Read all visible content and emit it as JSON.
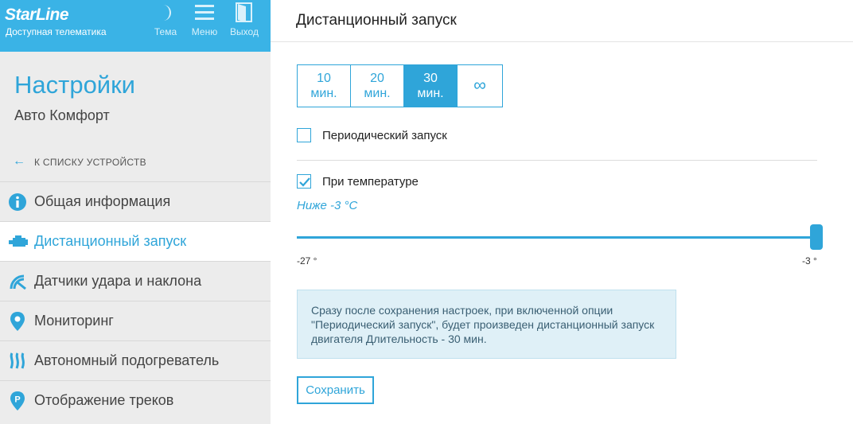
{
  "header": {
    "brand": "StarLine",
    "brand_sub": "Доступная телематика",
    "buttons": {
      "theme": "Тема",
      "menu": "Меню",
      "exit": "Выход"
    }
  },
  "sidebar": {
    "title": "Настройки",
    "subtitle": "Авто Комфорт",
    "back_label": "К СПИСКУ УСТРОЙСТВ",
    "items": [
      {
        "label": "Общая информация",
        "icon": "info-icon"
      },
      {
        "label": "Дистанционный запуск",
        "icon": "engine-icon",
        "active": true
      },
      {
        "label": "Датчики удара и наклона",
        "icon": "shock-sensor-icon"
      },
      {
        "label": "Мониторинг",
        "icon": "location-pin-icon"
      },
      {
        "label": "Автономный подогреватель",
        "icon": "heater-icon"
      },
      {
        "label": "Отображение треков",
        "icon": "parking-pin-icon"
      }
    ]
  },
  "main": {
    "title": "Дистанционный запуск",
    "durations": [
      {
        "value": "10",
        "unit": "мин."
      },
      {
        "value": "20",
        "unit": "мин."
      },
      {
        "value": "30",
        "unit": "мин.",
        "selected": true
      },
      {
        "value": "∞",
        "unit": ""
      }
    ],
    "periodic": {
      "label": "Периодический запуск",
      "checked": false
    },
    "temperature": {
      "label": "При температуре",
      "checked": true
    },
    "temp_note": "Ниже -3 °C",
    "slider": {
      "min_label": "-27 °",
      "max_label": "-3 °",
      "min": -27,
      "max": -3,
      "value": -3
    },
    "info": "Сразу после сохранения настроек, при включенной опции \"Периодический запуск\", будет произведен дистанционный запуск двигателя Длительность - 30 мин.",
    "save_label": "Сохранить"
  },
  "colors": {
    "accent": "#2fa5d9",
    "header_bg": "#3ab3e6",
    "sidebar_bg": "#ececec",
    "info_bg": "#dff0f7"
  }
}
